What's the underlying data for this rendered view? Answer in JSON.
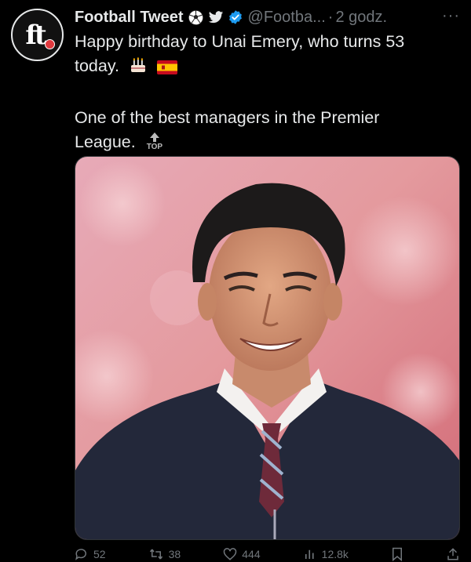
{
  "tweet": {
    "author_name": "Football Tweet",
    "handle": "@Footba...",
    "separator": "·",
    "time": "2 godz.",
    "avatar_text": "ft",
    "text_line1": "Happy birthday to Unai Emery, who turns 53 today.",
    "text_line2": "One of the best managers in the Premier League.",
    "top_badge": "TOP",
    "more_icon": "···"
  },
  "actions": {
    "reply_count": "52",
    "retweet_count": "38",
    "like_count": "444",
    "views_count": "12.8k"
  },
  "colors": {
    "background": "#000000",
    "text": "#e7e9ea",
    "muted": "#71767b",
    "verified": "#1d9bf0",
    "twitter": "#1d9bf0"
  }
}
